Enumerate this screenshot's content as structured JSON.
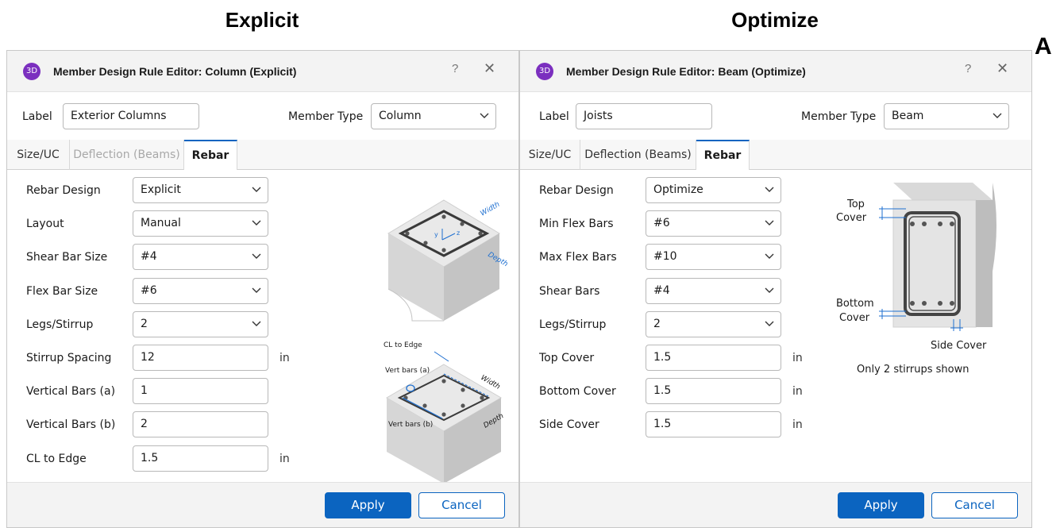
{
  "headings": {
    "left": "Explicit",
    "right": "Optimize",
    "panel_letter": "A"
  },
  "left": {
    "app_icon": "3D",
    "title": "Member Design Rule Editor: Column (Explicit)",
    "help": "?",
    "close": "✕",
    "label_caption": "Label",
    "label_value": "Exterior Columns",
    "member_type_caption": "Member Type",
    "member_type_value": "Column",
    "tabs": [
      {
        "label": "Size/UC",
        "state": "normal"
      },
      {
        "label": "Deflection (Beams)",
        "state": "disabled"
      },
      {
        "label": "Rebar",
        "state": "active"
      }
    ],
    "fields": [
      {
        "label": "Rebar Design",
        "value": "Explicit",
        "type": "select",
        "unit": ""
      },
      {
        "label": "Layout",
        "value": "Manual",
        "type": "select",
        "unit": ""
      },
      {
        "label": "Shear Bar Size",
        "value": "#4",
        "type": "select",
        "unit": ""
      },
      {
        "label": "Flex Bar Size",
        "value": "#6",
        "type": "select",
        "unit": ""
      },
      {
        "label": "Legs/Stirrup",
        "value": "2",
        "type": "select",
        "unit": ""
      },
      {
        "label": "Stirrup Spacing",
        "value": "12",
        "type": "text",
        "unit": "in"
      },
      {
        "label": "Vertical Bars (a)",
        "value": "1",
        "type": "text",
        "unit": ""
      },
      {
        "label": "Vertical Bars (b)",
        "value": "2",
        "type": "text",
        "unit": ""
      },
      {
        "label": "CL to Edge",
        "value": "1.5",
        "type": "text",
        "unit": "in"
      }
    ],
    "diagram_labels": {
      "width": "Width",
      "depth": "Depth",
      "cl_to_edge": "CL to Edge",
      "vert_a": "Vert bars (a)",
      "vert_b": "Vert bars (b)"
    },
    "apply": "Apply",
    "cancel": "Cancel"
  },
  "right": {
    "app_icon": "3D",
    "title": "Member Design Rule Editor: Beam (Optimize)",
    "help": "?",
    "close": "✕",
    "label_caption": "Label",
    "label_value": "Joists",
    "member_type_caption": "Member Type",
    "member_type_value": "Beam",
    "tabs": [
      {
        "label": "Size/UC",
        "state": "normal"
      },
      {
        "label": "Deflection (Beams)",
        "state": "normal"
      },
      {
        "label": "Rebar",
        "state": "active"
      }
    ],
    "fields": [
      {
        "label": "Rebar Design",
        "value": "Optimize",
        "type": "select",
        "unit": ""
      },
      {
        "label": "Min Flex Bars",
        "value": "#6",
        "type": "select",
        "unit": ""
      },
      {
        "label": "Max Flex Bars",
        "value": "#10",
        "type": "select",
        "unit": ""
      },
      {
        "label": "Shear Bars",
        "value": "#4",
        "type": "select",
        "unit": ""
      },
      {
        "label": "Legs/Stirrup",
        "value": "2",
        "type": "select",
        "unit": ""
      },
      {
        "label": "Top Cover",
        "value": "1.5",
        "type": "text",
        "unit": "in"
      },
      {
        "label": "Bottom Cover",
        "value": "1.5",
        "type": "text",
        "unit": "in"
      },
      {
        "label": "Side Cover",
        "value": "1.5",
        "type": "text",
        "unit": "in"
      }
    ],
    "diagram_labels": {
      "top": "Top",
      "cover_top": "Cover",
      "bottom": "Bottom",
      "cover_bottom": "Cover",
      "side_cover": "Side Cover",
      "note": "Only 2 stirrups shown"
    },
    "apply": "Apply",
    "cancel": "Cancel"
  },
  "colors": {
    "accent": "#0b64c0",
    "app_icon": "#7b2fbf",
    "dim_line": "#1e6fd0"
  }
}
